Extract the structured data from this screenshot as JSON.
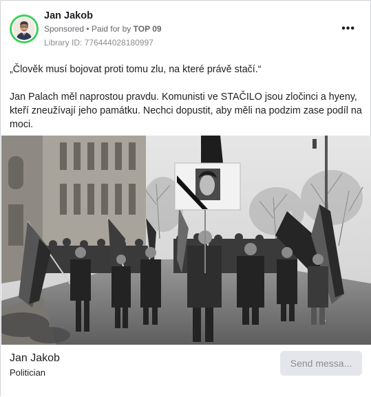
{
  "advertiser": {
    "name": "Jan Jakob",
    "sponsored_label": "Sponsored",
    "paid_for_prefix": " • Paid for by ",
    "paid_for_by": "TOP 09",
    "library_id": "Library ID: 776444028180997",
    "more_label": "•••"
  },
  "post": {
    "quote": "„Člověk musí bojovat proti tomu zlu, na které právě stačí.“",
    "body": "Jan Palach měl naprostou pravdu. Komunisti ve STAČILO jsou zločinci a hyeny, kteří zneužívají jeho památku. Nechci dopustit, aby měli na podzim zase podíl na moci."
  },
  "footer": {
    "page_name": "Jan Jakob",
    "category": "Politician",
    "cta_label": "Send messa..."
  },
  "colors": {
    "avatar_ring": "#3ecf5b",
    "button_bg": "#e4e6eb",
    "meta_text": "#65676b"
  },
  "icons": {
    "avatar": "profile-photo",
    "more": "three-dots-icon"
  }
}
